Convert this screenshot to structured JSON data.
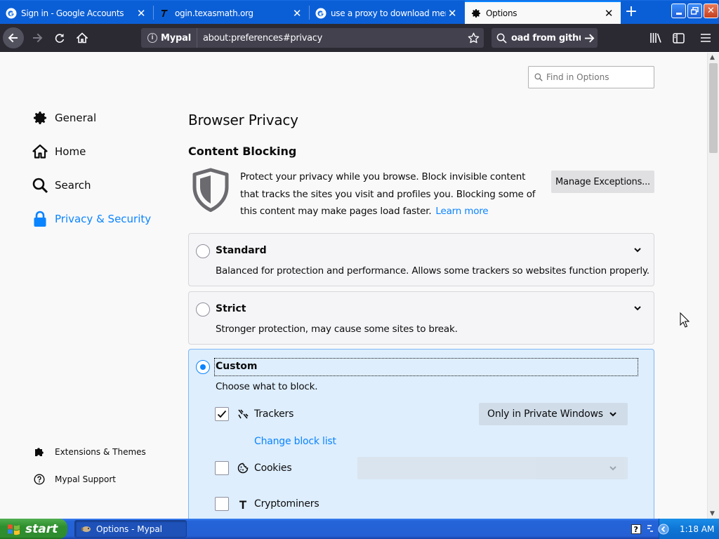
{
  "tabs": [
    {
      "title": "Sign in - Google Accounts",
      "favicon": "google-icon",
      "selected": false
    },
    {
      "title": "ogin.texasmath.org",
      "favicon": "texasmath-icon",
      "selected": false
    },
    {
      "title": "use a proxy to download memz -",
      "favicon": "google-icon",
      "selected": false
    },
    {
      "title": "Options",
      "favicon": "gear-icon",
      "selected": true
    }
  ],
  "navbar": {
    "identity_label": "Mypal",
    "url": "about:preferences#privacy",
    "search_text": "oad from github"
  },
  "find": {
    "placeholder": "Find in Options"
  },
  "sidebar": {
    "items": [
      {
        "label": "General",
        "icon": "gear-icon"
      },
      {
        "label": "Home",
        "icon": "home-icon"
      },
      {
        "label": "Search",
        "icon": "search-icon"
      },
      {
        "label": "Privacy & Security",
        "icon": "lock-icon",
        "active": true
      }
    ],
    "footer": [
      {
        "label": "Extensions & Themes",
        "icon": "puzzle-icon"
      },
      {
        "label": "Mypal Support",
        "icon": "help-icon"
      }
    ]
  },
  "main": {
    "title": "Browser Privacy",
    "section_title": "Content Blocking",
    "description": "Protect your privacy while you browse. Block invisible content that tracks the sites you visit and profiles you. Blocking some of this content may make pages load faster.",
    "learn_more": "Learn more",
    "manage_exceptions": "Manage Exceptions..."
  },
  "options": {
    "standard": {
      "title": "Standard",
      "description": "Balanced for protection and performance. Allows some trackers so websites function properly.",
      "selected": false
    },
    "strict": {
      "title": "Strict",
      "description": "Stronger protection, may cause some sites to break.",
      "selected": false
    },
    "custom": {
      "title": "Custom",
      "description": "Choose what to block.",
      "selected": true,
      "trackers": {
        "label": "Trackers",
        "checked": true,
        "dropdown": "Only in Private Windows",
        "link": "Change block list"
      },
      "cookies": {
        "label": "Cookies",
        "checked": false,
        "dropdown": ""
      },
      "cryptominers": {
        "label": "Cryptominers",
        "checked": false
      }
    }
  },
  "taskbar": {
    "start_label": "start",
    "task_label": "Options - Mypal",
    "clock": "1:18 AM"
  },
  "colors": {
    "accent": "#0a84ff",
    "tabstrip": "#0b5fd6",
    "toolbar": "#2b2a33",
    "custom_card": "#deeefd"
  }
}
